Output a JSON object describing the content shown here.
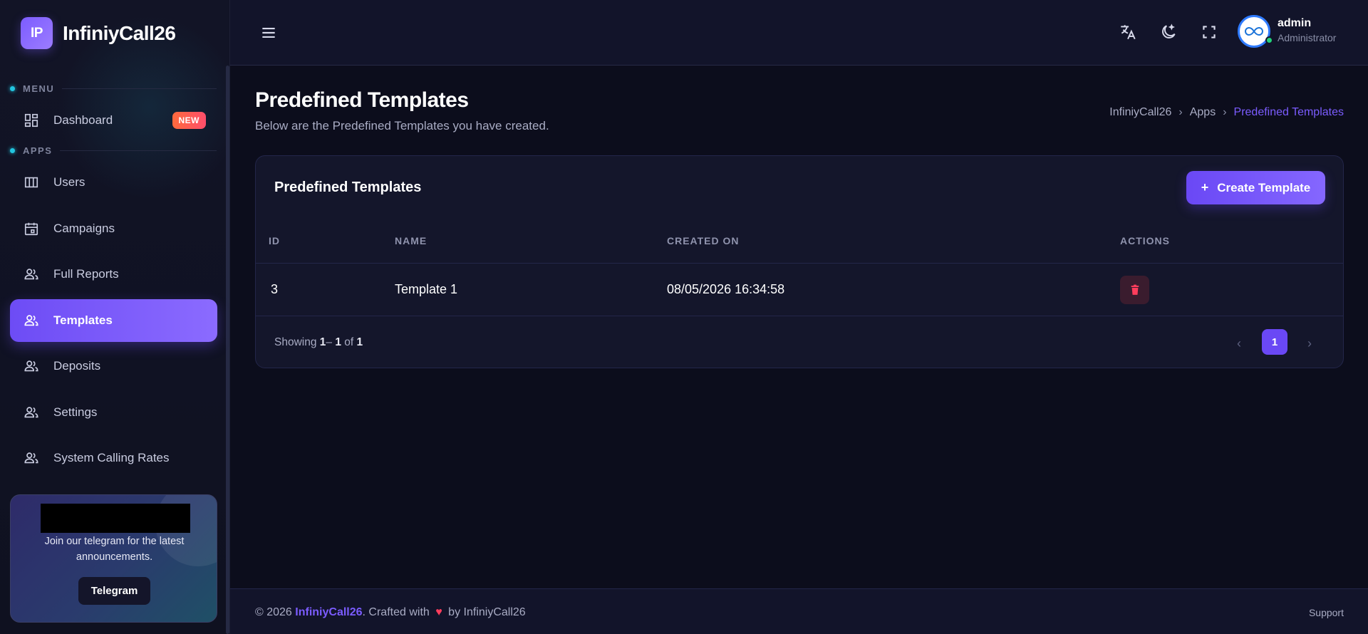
{
  "brand": {
    "logo_text": "IP",
    "name": "InfiniyCall26"
  },
  "sidebar": {
    "sections": [
      {
        "label": "MENU"
      },
      {
        "label": "APPS"
      }
    ],
    "dashboard": {
      "label": "Dashboard",
      "badge": "NEW"
    },
    "items": [
      {
        "label": "Users",
        "icon": "columns-icon"
      },
      {
        "label": "Campaigns",
        "icon": "calendar-icon"
      },
      {
        "label": "Full Reports",
        "icon": "users-icon"
      },
      {
        "label": "Templates",
        "icon": "users-icon",
        "active": true
      },
      {
        "label": "Deposits",
        "icon": "users-icon"
      },
      {
        "label": "Settings",
        "icon": "users-icon"
      },
      {
        "label": "System Calling Rates",
        "icon": "users-icon"
      }
    ],
    "promo": {
      "text": "Join our telegram for the latest announcements.",
      "button": "Telegram"
    }
  },
  "header": {
    "user_name": "admin",
    "user_role": "Administrator"
  },
  "page": {
    "title": "Predefined Templates",
    "subtitle": "Below are the Predefined Templates you have created.",
    "breadcrumb": [
      "InfiniyCall26",
      "Apps",
      "Predefined Templates"
    ]
  },
  "card": {
    "title": "Predefined Templates",
    "create_button": "Create Template",
    "columns": [
      "ID",
      "NAME",
      "CREATED ON",
      "ACTIONS"
    ],
    "rows": [
      {
        "id": "3",
        "name": "Template 1",
        "created_on": "08/05/2026 16:34:58"
      }
    ],
    "showing": {
      "prefix": "Showing ",
      "from": "1",
      "dash": "– ",
      "to": "1",
      "of": " of ",
      "total": "1"
    },
    "pagination": {
      "current": "1",
      "prev": "‹",
      "next": "›"
    }
  },
  "footer": {
    "copyright": "© 2026 ",
    "brand": "InfiniyCall26",
    "crafted": ". Crafted with ",
    "heart": "♥",
    "by": " by InfiniyCall26",
    "support": "Support"
  },
  "colors": {
    "accent": "#6d4cf5",
    "danger": "#ff3d5c",
    "background": "#0c0d1c"
  }
}
